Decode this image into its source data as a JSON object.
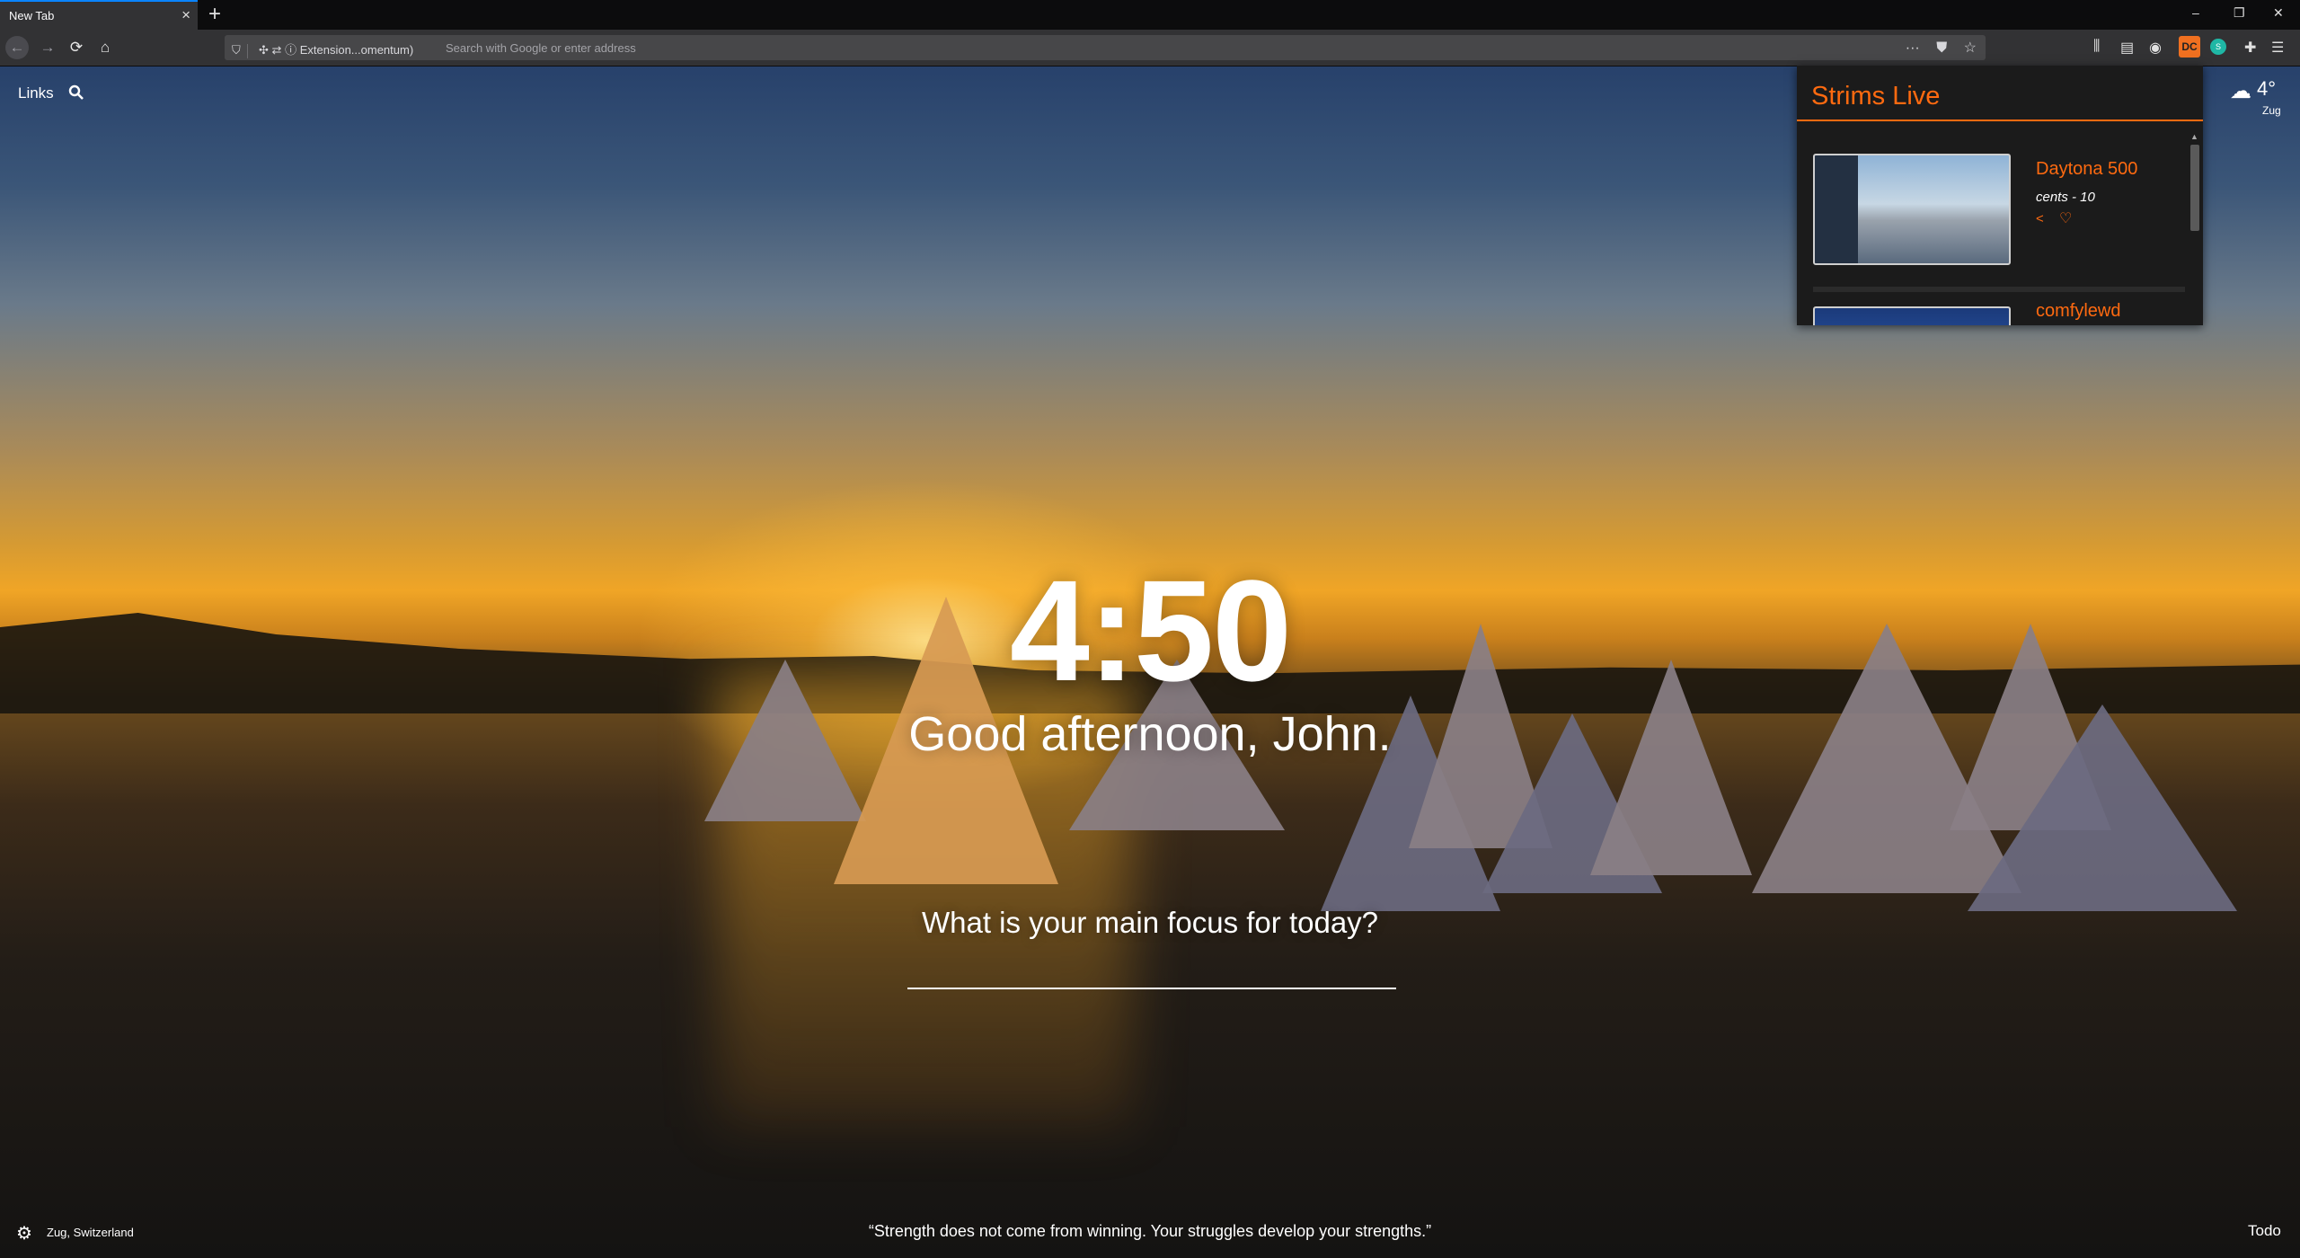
{
  "browser": {
    "tab_title": "New Tab",
    "tab_close_icon": "close-icon",
    "new_tab_icon": "plus-icon",
    "window_controls": [
      "–",
      "❐",
      "✕"
    ],
    "identity_label": "Extension...omentum)",
    "url_placeholder": "Search with Google or enter address",
    "accent_color": "#0a84ff"
  },
  "extensions": {
    "strims_badge": "DC",
    "teal_badge": "S"
  },
  "dashboard": {
    "links_label": "Links",
    "weather": {
      "temperature": "4°",
      "city": "Zug",
      "icon": "snow-cloud-icon"
    },
    "clock": "4:50",
    "greeting": "Good afternoon, John.",
    "focus_question": "What is your main focus for today?",
    "focus_value": "",
    "location": "Zug, Switzerland",
    "quote": "“Strength does not come from winning. Your struggles develop your strengths.”",
    "todo_label": "Todo"
  },
  "strims": {
    "title": "Strims Live",
    "accent_color": "#ff6a10",
    "streams": [
      {
        "name": "Daytona 500",
        "subtitle": "cents - 10"
      },
      {
        "name": "comfylewd",
        "subtitle": ""
      }
    ]
  }
}
